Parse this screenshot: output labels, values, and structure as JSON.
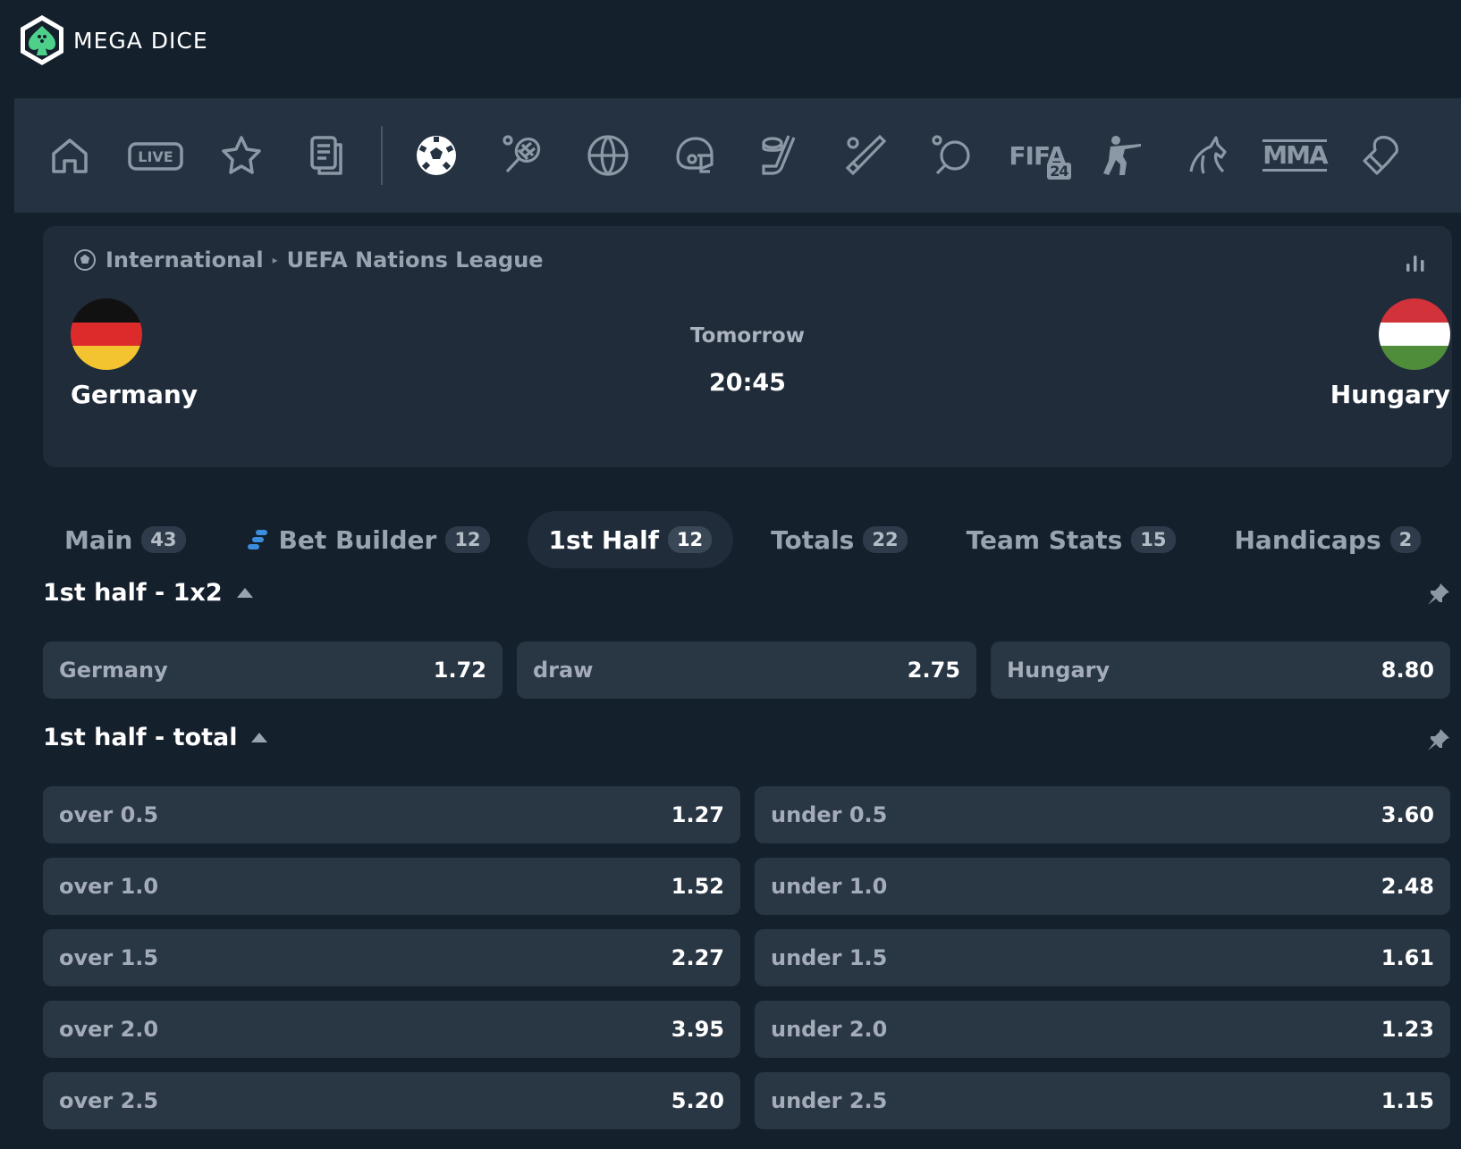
{
  "brand": {
    "name": "MEGA DICE"
  },
  "sports_nav": {
    "items": [
      {
        "name": "home-icon"
      },
      {
        "name": "live-icon",
        "label": "LIVE"
      },
      {
        "name": "star-icon"
      },
      {
        "name": "betslip-icon"
      },
      {
        "name": "soccer-icon",
        "active": true
      },
      {
        "name": "tennis-icon"
      },
      {
        "name": "basketball-icon"
      },
      {
        "name": "american-football-icon"
      },
      {
        "name": "hockey-icon"
      },
      {
        "name": "baseball-icon"
      },
      {
        "name": "table-tennis-icon"
      },
      {
        "name": "fifa-icon",
        "label": "FIFA",
        "sub": "24"
      },
      {
        "name": "counter-strike-icon"
      },
      {
        "name": "horse-racing-icon"
      },
      {
        "name": "mma-icon",
        "label": "MMA"
      },
      {
        "name": "boxing-icon"
      }
    ]
  },
  "match": {
    "breadcrumb": {
      "region": "International",
      "league": "UEFA Nations League"
    },
    "home": {
      "name": "Germany"
    },
    "away": {
      "name": "Hungary"
    },
    "day": "Tomorrow",
    "time": "20:45"
  },
  "tabs": [
    {
      "label": "Main",
      "count": "43"
    },
    {
      "label": "Bet Builder",
      "count": "12"
    },
    {
      "label": "1st Half",
      "count": "12",
      "active": true
    },
    {
      "label": "Totals",
      "count": "22"
    },
    {
      "label": "Team Stats",
      "count": "15"
    },
    {
      "label": "Handicaps",
      "count": "2"
    }
  ],
  "markets": {
    "m1": {
      "title": "1st half - 1x2",
      "outcomes": [
        {
          "label": "Germany",
          "odd": "1.72"
        },
        {
          "label": "draw",
          "odd": "2.75"
        },
        {
          "label": "Hungary",
          "odd": "8.80"
        }
      ]
    },
    "m2": {
      "title": "1st half - total",
      "rows": [
        [
          {
            "label": "over 0.5",
            "odd": "1.27"
          },
          {
            "label": "under 0.5",
            "odd": "3.60"
          }
        ],
        [
          {
            "label": "over 1.0",
            "odd": "1.52"
          },
          {
            "label": "under 1.0",
            "odd": "2.48"
          }
        ],
        [
          {
            "label": "over 1.5",
            "odd": "2.27"
          },
          {
            "label": "under 1.5",
            "odd": "1.61"
          }
        ],
        [
          {
            "label": "over 2.0",
            "odd": "3.95"
          },
          {
            "label": "under 2.0",
            "odd": "1.23"
          }
        ],
        [
          {
            "label": "over 2.5",
            "odd": "5.20"
          },
          {
            "label": "under 2.5",
            "odd": "1.15"
          }
        ]
      ]
    }
  },
  "colors": {
    "background": "#15202d",
    "nav_bar": "#253241",
    "card": "#202c3a",
    "odd_button": "#293644",
    "germany_flag": [
      "#111111",
      "#dd2b2b",
      "#f4c430"
    ],
    "hungary_flag": [
      "#d2323a",
      "#ffffff",
      "#4f8d3a"
    ],
    "bet_builder_accent": "#3b8de0",
    "logo_accent": "#4fd08a"
  }
}
